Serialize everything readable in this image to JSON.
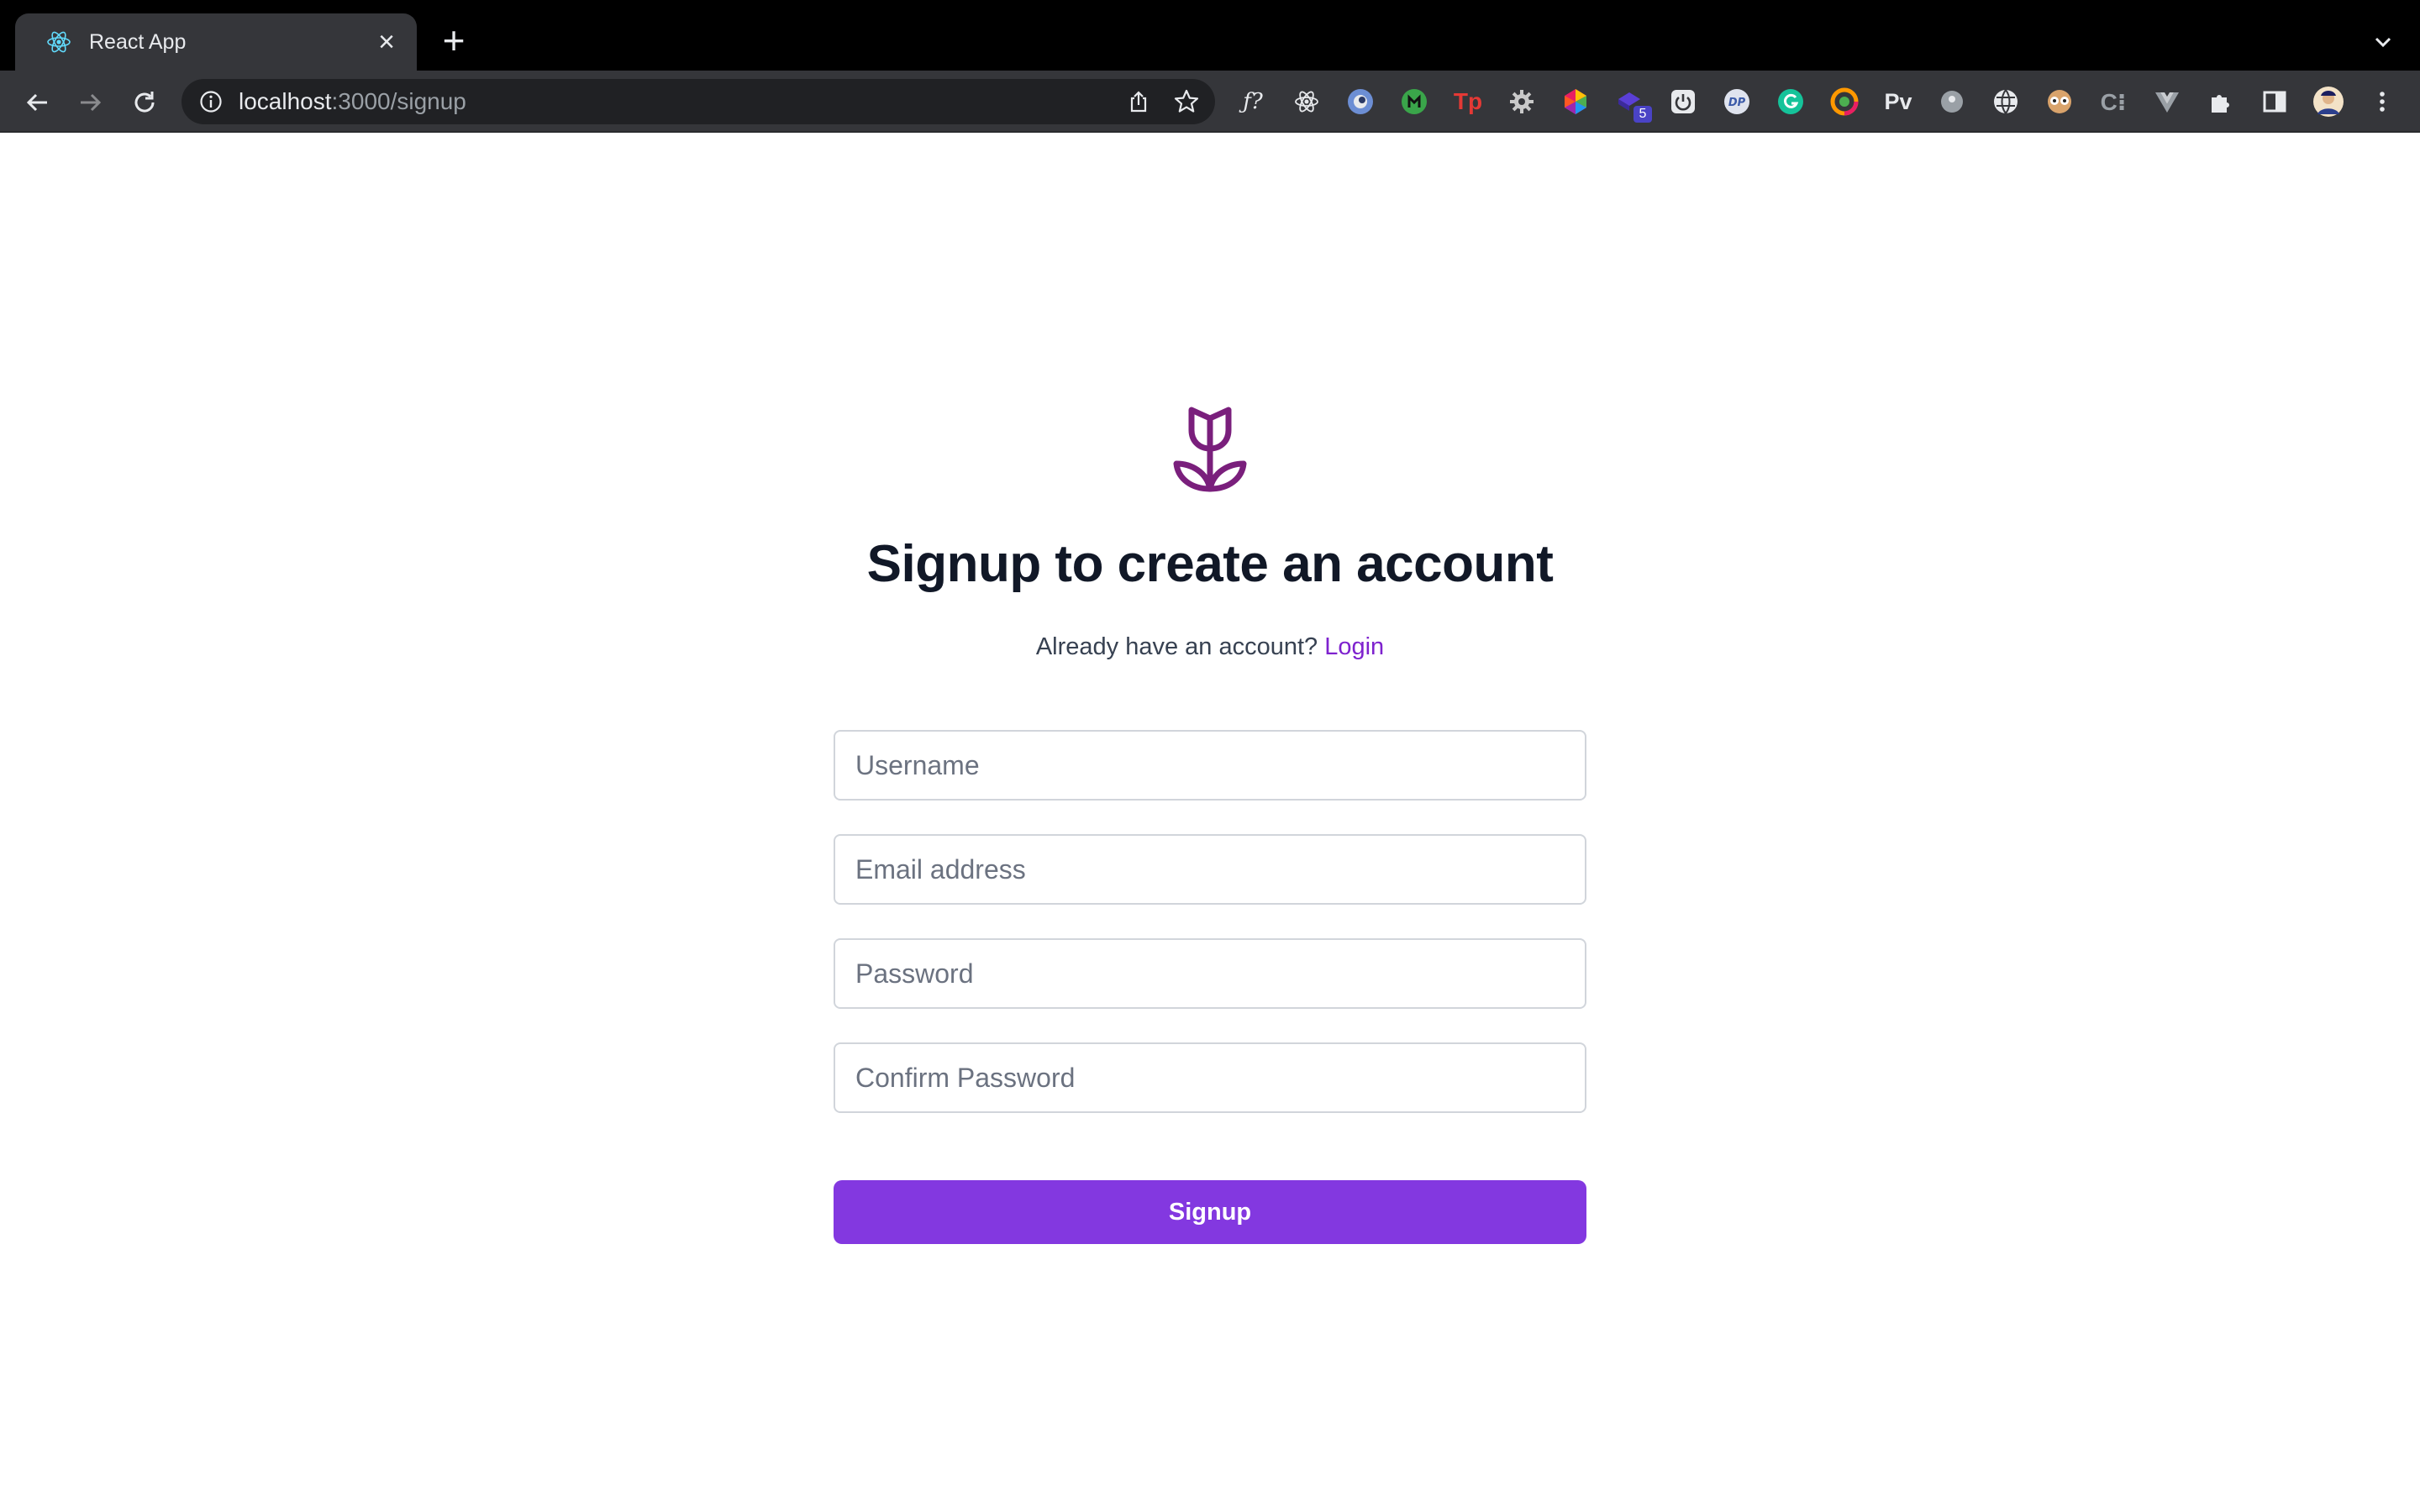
{
  "browser": {
    "tab_title": "React App",
    "tab_close_glyph": "×",
    "new_tab_glyph": "+",
    "url_host": "localhost",
    "url_path": ":3000/signup",
    "icons": {
      "back": "back-arrow-icon",
      "forward": "forward-arrow-icon",
      "reload": "reload-icon",
      "site_info": "info-icon",
      "share": "share-icon",
      "bookmark": "star-icon",
      "tab_search": "chevron-down-icon",
      "menu": "kebab-menu-icon"
    },
    "extensions": {
      "fx_label": "ƒ?",
      "pv_label": "Pv",
      "badge_count": "5",
      "tp_label": "Tp",
      "c_label": "C⁝"
    },
    "colors": {
      "tabstrip": "#000000",
      "toolbar": "#35363a",
      "omnibox": "#202124"
    }
  },
  "page": {
    "logo_icon": "tulip-icon",
    "heading": "Signup to create an account",
    "subtext": "Already have an account?",
    "login_link": "Login",
    "fields": {
      "username_placeholder": "Username",
      "email_placeholder": "Email address",
      "password_placeholder": "Password",
      "confirm_placeholder": "Confirm Password"
    },
    "submit_label": "Signup",
    "colors": {
      "accent": "#8338e0",
      "logo": "#7a1f7c",
      "heading": "#111827",
      "link": "#7e22ce"
    }
  }
}
